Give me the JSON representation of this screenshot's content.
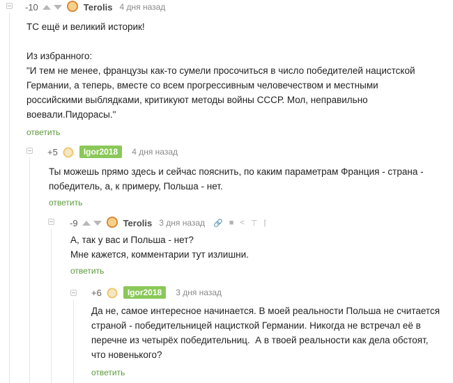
{
  "comments": [
    {
      "rating": "-10",
      "author": "Terolis",
      "time": "4 дня назад",
      "text": "ТС ещё и великий историк!\n\nИз избранного:\n\"И тем не менее, французы как-то сумели просочиться в число победителей нацистской\nГермании, а теперь, вместе со всем прогрессивным человечеством и местными\nроссийскими выблядками, критикуют методы войны СССР. Мол, неправильно\nвоевали.Пидорасы.\"",
      "reply": "ответить"
    },
    {
      "rating": "+5",
      "author": "Igor2018",
      "time": "4 дня назад",
      "text": "Ты можешь прямо здесь и сейчас пояснить, по каким параметрам Франция - страна -\nпобедитель, а, к примеру, Польша - нет.",
      "reply": "ответить"
    },
    {
      "rating": "-9",
      "author": "Terolis",
      "time": "3 дня назад",
      "text": "А, так у вас и Польша - нет?\nМне кажется, комментарии тут излишни.",
      "reply": "ответить"
    },
    {
      "rating": "+6",
      "author": "Igor2018",
      "time": "3 дня назад",
      "text": "Да не, самое интересное начинается. В моей реальности Польша не считается\nстраной - победительницей нацисткой Германии. Никогда не встречал её в\nперечне из четырёх победительниц.  А в твоей реальности как дела обстоят,\nчто новенького?",
      "reply": "ответить"
    }
  ],
  "colors": {
    "reply_link": "#5c9a3c",
    "badge_bg": "#8ac858",
    "muted": "#8a8a8a"
  },
  "icons": [
    "link-icon",
    "save-icon",
    "share-icon",
    "pin-icon",
    "more-icon"
  ]
}
